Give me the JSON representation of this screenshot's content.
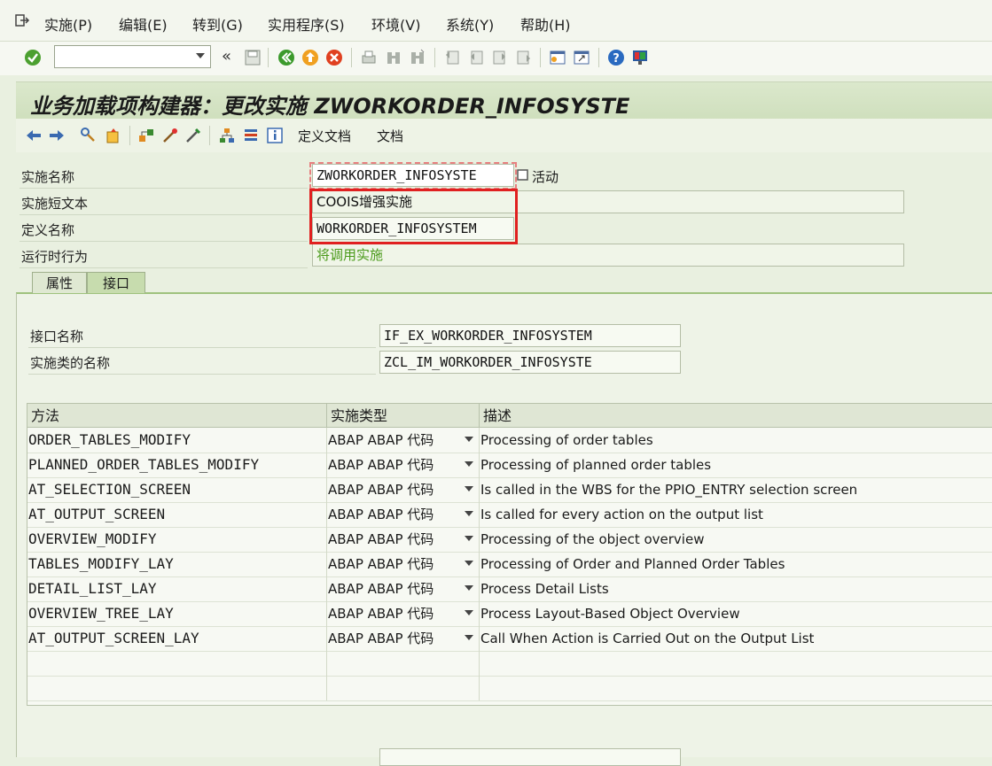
{
  "menu": {
    "items": [
      "实施(P)",
      "编辑(E)",
      "转到(G)",
      "实用程序(S)",
      "环境(V)",
      "系统(Y)",
      "帮助(H)"
    ]
  },
  "command_field": {
    "value": ""
  },
  "title": {
    "prefix": "业务加载项构建器：更改实施",
    "code": "ZWORKORDER_INFOSYSTE"
  },
  "app_toolbar": {
    "def_doc": "定义文档",
    "doc": "文档"
  },
  "header": {
    "impl_name_label": "实施名称",
    "impl_name_value": "ZWORKORDER_INFOSYSTE",
    "active_label": "活动",
    "short_text_label": "实施短文本",
    "short_text_value": "COOIS增强实施",
    "def_name_label": "定义名称",
    "def_name_value": "WORKORDER_INFOSYSTEM",
    "runtime_label": "运行时行为",
    "runtime_value": "将调用实施"
  },
  "tabs": [
    "属性",
    "接口"
  ],
  "interface": {
    "name_label": "接口名称",
    "name_value": "IF_EX_WORKORDER_INFOSYSTEM",
    "class_label": "实施类的名称",
    "class_value": "ZCL_IM_WORKORDER_INFOSYSTE"
  },
  "table": {
    "headers": [
      "方法",
      "实施类型",
      "描述"
    ],
    "rows": [
      {
        "method": "ORDER_TABLES_MODIFY",
        "type": "ABAP ABAP 代码",
        "desc": "Processing of order tables"
      },
      {
        "method": "PLANNED_ORDER_TABLES_MODIFY",
        "type": "ABAP ABAP 代码",
        "desc": "Processing of planned order tables"
      },
      {
        "method": "AT_SELECTION_SCREEN",
        "type": "ABAP ABAP 代码",
        "desc": "Is called in the WBS for the PPIO_ENTRY selection screen"
      },
      {
        "method": "AT_OUTPUT_SCREEN",
        "type": "ABAP ABAP 代码",
        "desc": "Is called for every action on the output list"
      },
      {
        "method": "OVERVIEW_MODIFY",
        "type": "ABAP ABAP 代码",
        "desc": "Processing of the object overview"
      },
      {
        "method": "TABLES_MODIFY_LAY",
        "type": "ABAP ABAP 代码",
        "desc": "Processing of Order and Planned Order Tables"
      },
      {
        "method": "DETAIL_LIST_LAY",
        "type": "ABAP ABAP 代码",
        "desc": "Process Detail Lists"
      },
      {
        "method": "OVERVIEW_TREE_LAY",
        "type": "ABAP ABAP 代码",
        "desc": "Process Layout-Based Object Overview"
      },
      {
        "method": "AT_OUTPUT_SCREEN_LAY",
        "type": "ABAP ABAP 代码",
        "desc": "Call When Action is Carried Out on the Output List"
      }
    ]
  },
  "colors": {
    "highlight_border": "#e02020",
    "runtime_text": "#4a9a1a"
  }
}
